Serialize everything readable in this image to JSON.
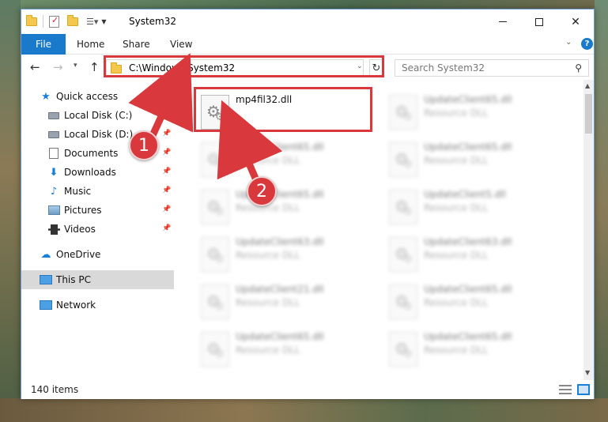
{
  "window": {
    "title": "System32"
  },
  "ribbon": {
    "file": "File",
    "tabs": [
      "Home",
      "Share",
      "View"
    ]
  },
  "address": {
    "path": "C:\\Windows\\System32"
  },
  "search": {
    "placeholder": "Search System32"
  },
  "sidebar": {
    "items": [
      {
        "label": "Quick access"
      },
      {
        "label": "Local Disk (C:)"
      },
      {
        "label": "Local Disk (D:)"
      },
      {
        "label": "Documents"
      },
      {
        "label": "Downloads"
      },
      {
        "label": "Music"
      },
      {
        "label": "Pictures"
      },
      {
        "label": "Videos"
      },
      {
        "label": "OneDrive"
      },
      {
        "label": "This PC"
      },
      {
        "label": "Network"
      }
    ]
  },
  "files": [
    {
      "name": "mp4fil32.dll",
      "type": ""
    },
    {
      "name": "UpdateClient65.dll",
      "type": "Resource DLL"
    },
    {
      "name": "UpdateClient65.dll",
      "type": "Resource DLL"
    },
    {
      "name": "UpdateClient65.dll",
      "type": "Resource DLL"
    },
    {
      "name": "UpdateClient65.dll",
      "type": "Resource DLL"
    },
    {
      "name": "UpdateClient5.dll",
      "type": "Resource DLL"
    },
    {
      "name": "UpdateClient63.dll",
      "type": "Resource DLL"
    },
    {
      "name": "UpdateClient63.dll",
      "type": "Resource DLL"
    },
    {
      "name": "UpdateClient21.dll",
      "type": "Resource DLL"
    },
    {
      "name": "UpdateClient65.dll",
      "type": "Resource DLL"
    },
    {
      "name": "UpdateClient65.dll",
      "type": "Resource DLL"
    },
    {
      "name": "UpdateClient65.dll",
      "type": "Resource DLL"
    }
  ],
  "status": {
    "count": "140 items"
  },
  "annotations": {
    "step1": "1",
    "step2": "2",
    "color": "#d9393d"
  }
}
